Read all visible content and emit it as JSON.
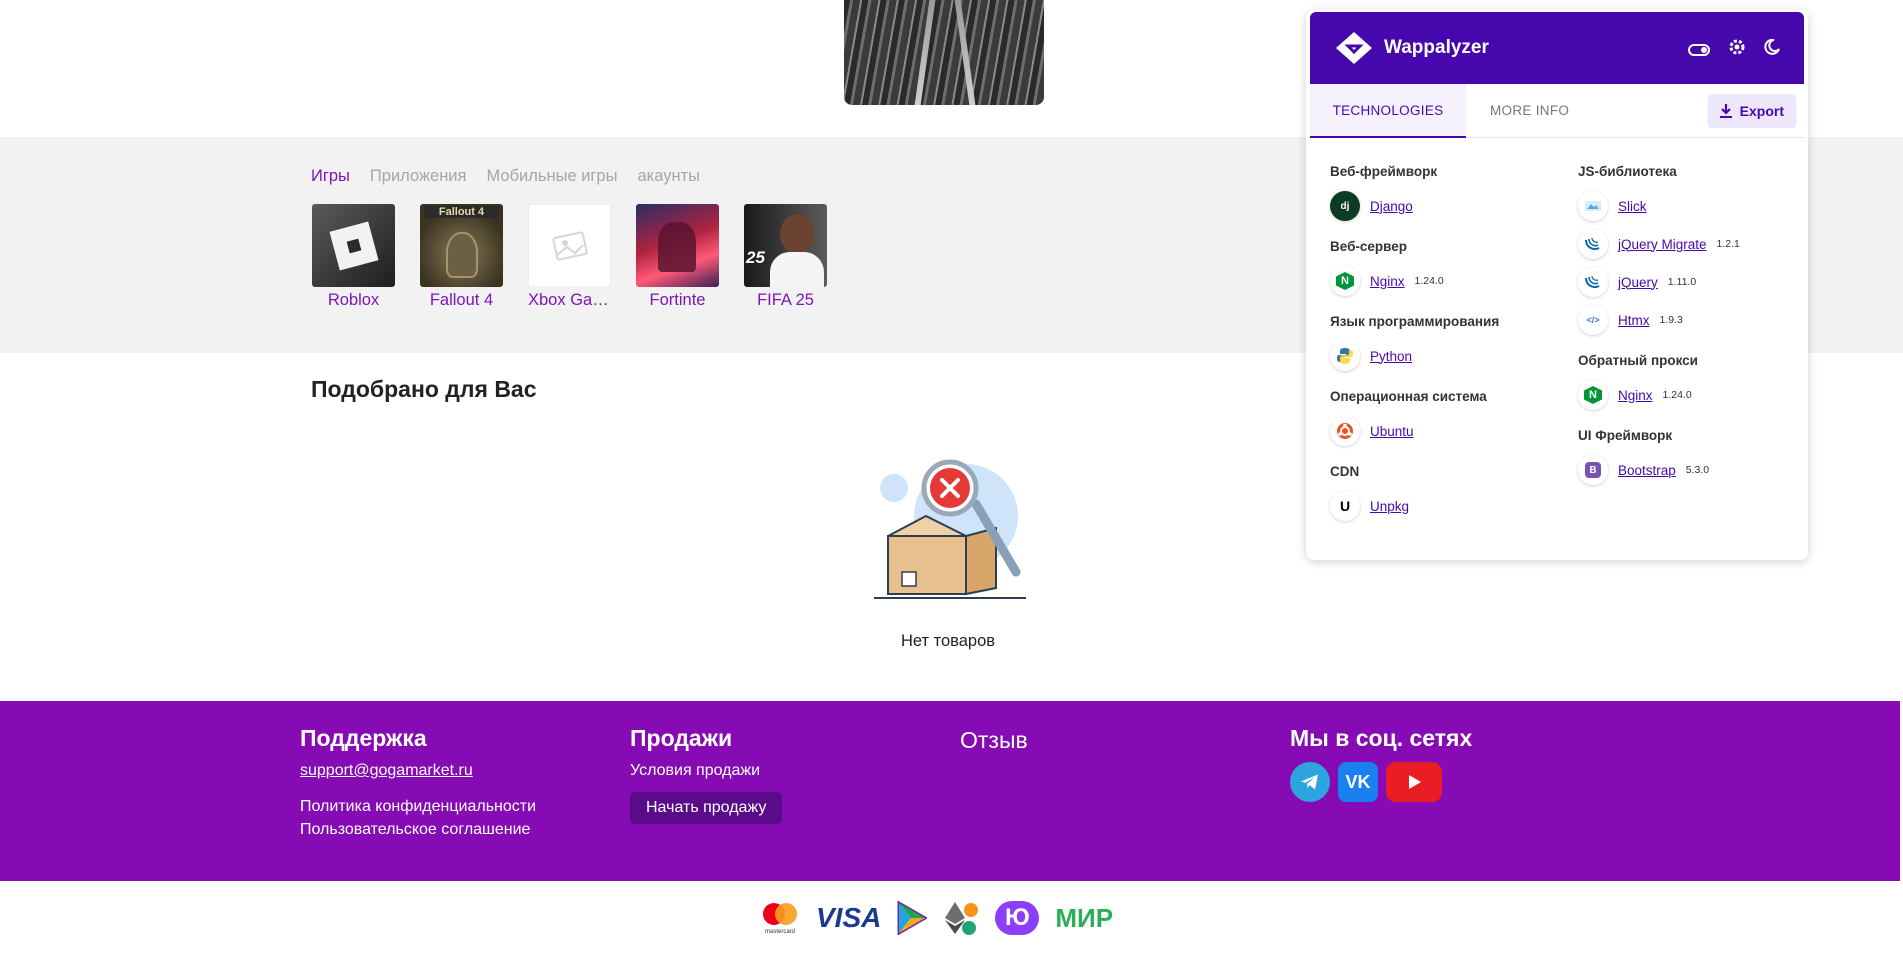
{
  "categories": {
    "tabs": [
      {
        "label": "Игры",
        "active": true
      },
      {
        "label": "Приложения",
        "active": false
      },
      {
        "label": "Мобильные игры",
        "active": false
      },
      {
        "label": "акаунты",
        "active": false
      }
    ],
    "games": [
      {
        "name": "Roblox"
      },
      {
        "name": "Fallout 4",
        "logo_text": "Fallout 4"
      },
      {
        "name": "Xbox Game Pass"
      },
      {
        "name": "Fortinte"
      },
      {
        "name": "FIFA 25",
        "logo_text": "25"
      }
    ]
  },
  "recommended": {
    "title": "Подобрано для Вас",
    "empty_text": "Нет товаров"
  },
  "footer": {
    "support": {
      "title": "Поддержка",
      "email": "support@gogamarket.ru",
      "privacy": "Политика конфиденциальности",
      "agreement": "Пользовательское соглашение"
    },
    "sales": {
      "title": "Продажи",
      "terms": "Условия продажи",
      "start_button": "Начать продажу"
    },
    "review": {
      "title": "Отзыв"
    },
    "social": {
      "title": "Мы в соц. сетях",
      "networks": [
        "telegram-icon",
        "vk-icon",
        "youtube-icon"
      ],
      "vk_label": "VK"
    },
    "background": "#860bb4"
  },
  "payments": {
    "methods": [
      "mastercard-icon",
      "visa-icon",
      "sbp-icon",
      "crypto-icon",
      "yoomoney-icon",
      "mir-icon"
    ],
    "mastercard_label": "mastercard",
    "visa_label": "VISA",
    "yoomoney_label": "Ю",
    "mir_label": "МИР"
  },
  "wappalyzer": {
    "title": "Wappalyzer",
    "header_color": "#4608ad",
    "tabs": {
      "technologies": "TECHNOLOGIES",
      "more_info": "MORE INFO"
    },
    "export_label": "Export",
    "left_column": [
      {
        "category": "Веб-фреймворк",
        "items": [
          {
            "name": "Django",
            "version": "",
            "icon": "django-icon",
            "icon_text": "dj"
          }
        ]
      },
      {
        "category": "Веб-сервер",
        "items": [
          {
            "name": "Nginx",
            "version": "1.24.0",
            "icon": "nginx-icon",
            "icon_text": "N"
          }
        ]
      },
      {
        "category": "Язык программирования",
        "items": [
          {
            "name": "Python",
            "version": "",
            "icon": "python-icon",
            "icon_text": ""
          }
        ]
      },
      {
        "category": "Операционная система",
        "items": [
          {
            "name": "Ubuntu",
            "version": "",
            "icon": "ubuntu-icon",
            "icon_text": ""
          }
        ]
      },
      {
        "category": "CDN",
        "items": [
          {
            "name": "Unpkg",
            "version": "",
            "icon": "unpkg-icon",
            "icon_text": "U"
          }
        ]
      }
    ],
    "right_column": [
      {
        "category": "JS-библиотека",
        "items": [
          {
            "name": "Slick",
            "version": "",
            "icon": "slick-icon",
            "icon_text": ""
          },
          {
            "name": "jQuery Migrate",
            "version": "1.2.1",
            "icon": "jquery-migrate-icon",
            "icon_text": ""
          },
          {
            "name": "jQuery",
            "version": "1.11.0",
            "icon": "jquery-icon",
            "icon_text": ""
          },
          {
            "name": "Htmx",
            "version": "1.9.3",
            "icon": "htmx-icon",
            "icon_text": "</>"
          }
        ]
      },
      {
        "category": "Обратный прокси",
        "items": [
          {
            "name": "Nginx",
            "version": "1.24.0",
            "icon": "nginx-icon",
            "icon_text": "N"
          }
        ]
      },
      {
        "category": "UI Фреймворк",
        "items": [
          {
            "name": "Bootstrap",
            "version": "5.3.0",
            "icon": "bootstrap-icon",
            "icon_text": "B"
          }
        ]
      }
    ]
  }
}
